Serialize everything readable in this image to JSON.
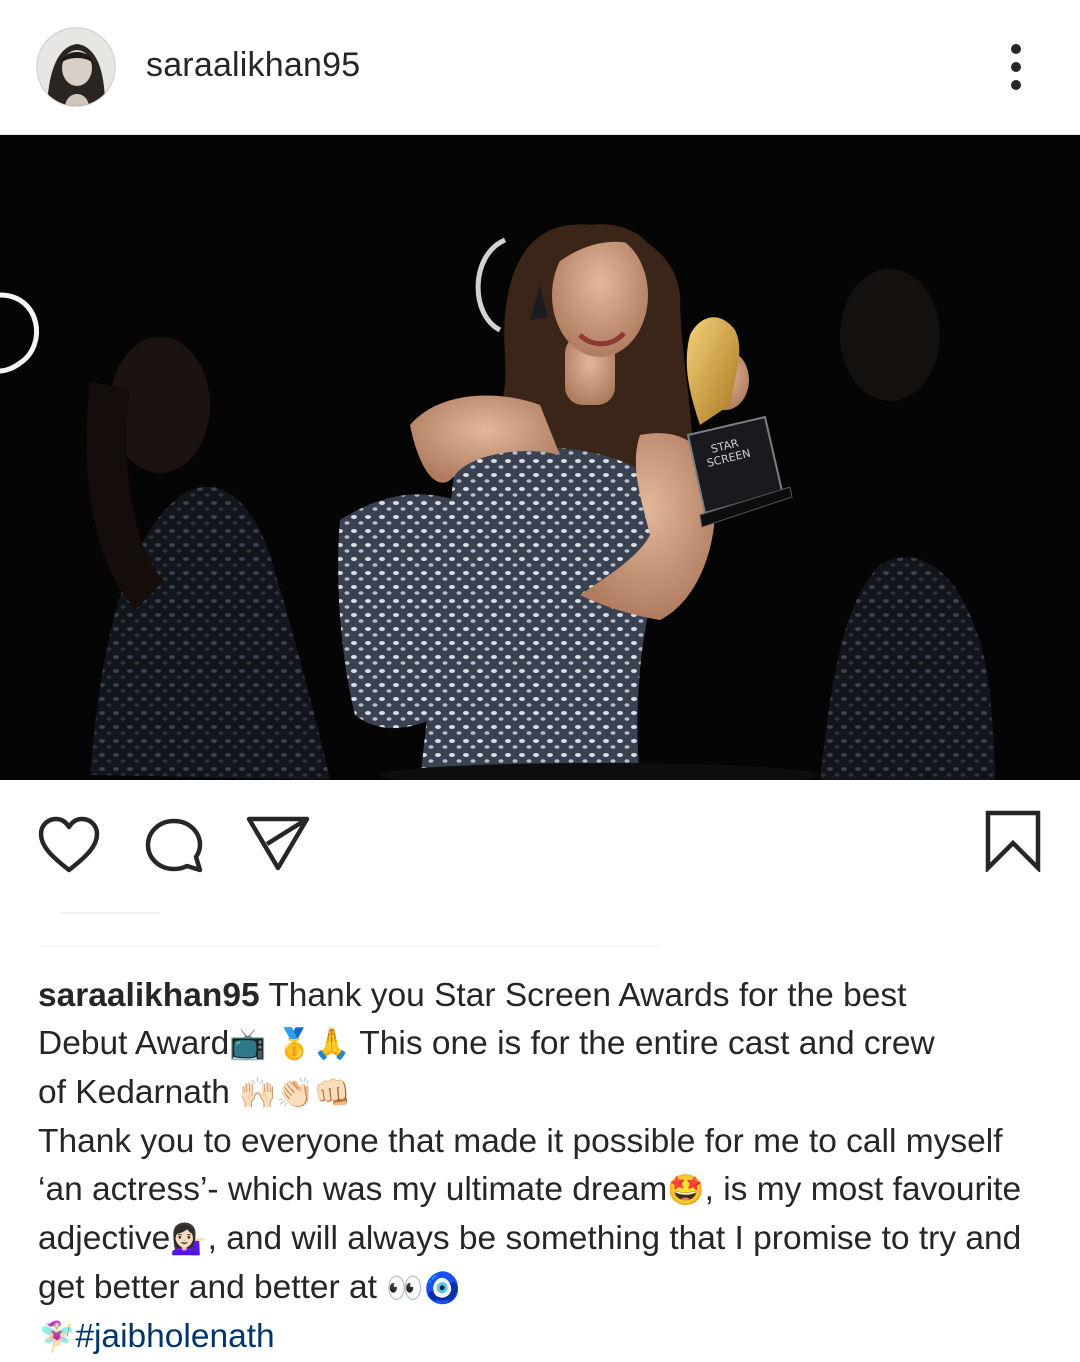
{
  "header": {
    "username": "saraalikhan95",
    "avatar_icon": "profile-photo",
    "more_icon": "more-vertical-icon"
  },
  "post": {
    "image_icon": "award-photo",
    "trophy_text": [
      "STAR",
      "SCREEN"
    ]
  },
  "actions": {
    "like_icon": "heart-icon",
    "comment_icon": "comment-icon",
    "share_icon": "send-icon",
    "save_icon": "bookmark-icon"
  },
  "caption": {
    "user": "saraalikhan95",
    "line1_rest": " Thank you Star Screen Awards for the best",
    "line2a": "Debut Award",
    "emoji_tv": "📺",
    "emoji_medal": "🥇",
    "emoji_pray": "🙏",
    "line2b": " This one is for the entire cast and crew",
    "line3": "of Kedarnath ",
    "emoji_hands": "🙌🏻👏🏻👊🏻",
    "para2a": "Thank you to everyone that made it possible for me to call myself ‘an actress’- which was my ultimate dream",
    "emoji_star_eyes": "🤩",
    "para2b": ", is my most favourite adjective",
    "emoji_woman": "💁🏻‍♀️",
    "para2c": ", and will always be something that I promise to try and get better and better at ",
    "emoji_eyes": "👀",
    "emoji_nazar": "🧿",
    "emoji_fairy": "🧚🏻‍♀️",
    "hashtag": "#jaibholenath"
  },
  "colors": {
    "text": "#262626",
    "hashtag": "#003569",
    "photo_bg": "#050505"
  }
}
